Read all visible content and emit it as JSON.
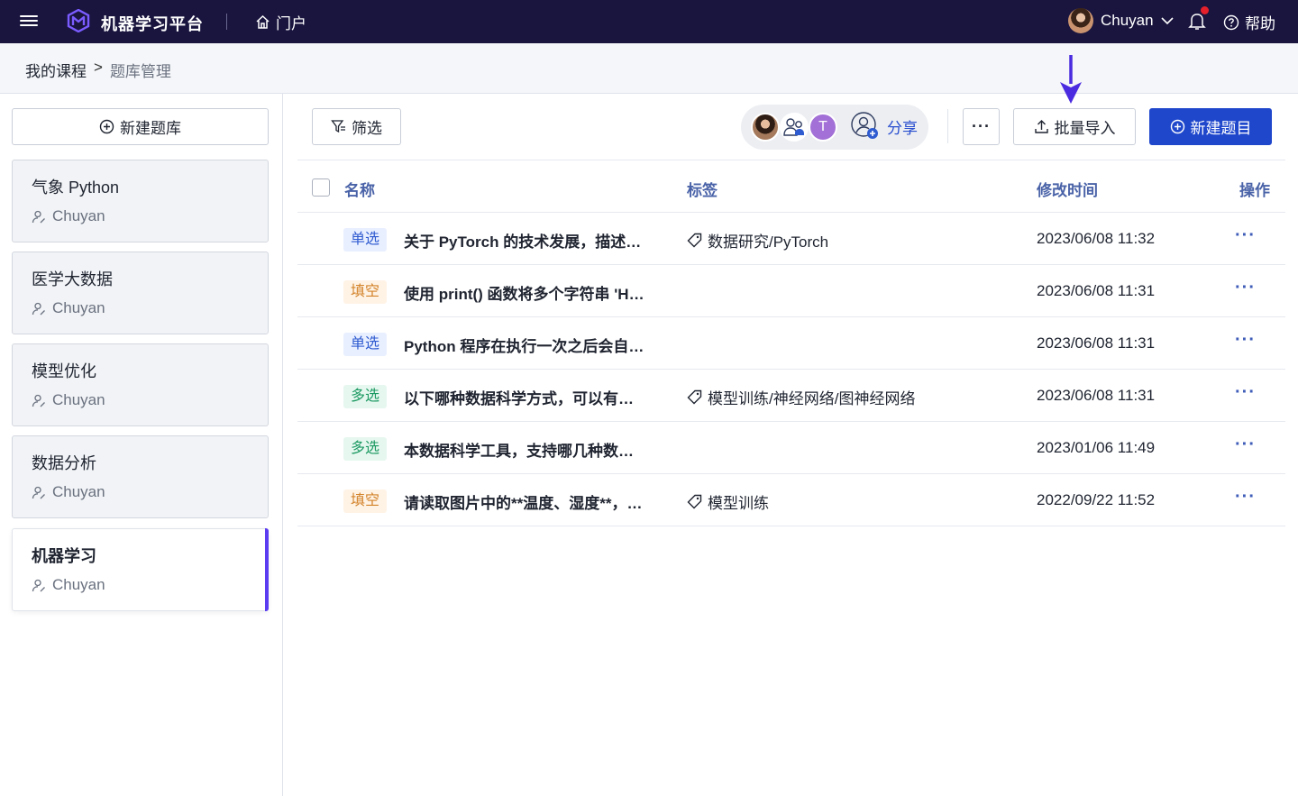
{
  "header": {
    "app_title": "机器学习平台",
    "portal_label": "门户",
    "user_name": "Chuyan",
    "help_label": "帮助"
  },
  "breadcrumb": {
    "parent": "我的课程",
    "separator": ">",
    "current": "题库管理"
  },
  "sidebar": {
    "new_bank_label": "新建题库",
    "banks": [
      {
        "name": "气象 Python",
        "owner": "Chuyan"
      },
      {
        "name": "医学大数据",
        "owner": "Chuyan"
      },
      {
        "name": "模型优化",
        "owner": "Chuyan"
      },
      {
        "name": "数据分析",
        "owner": "Chuyan"
      },
      {
        "name": "机器学习",
        "owner": "Chuyan",
        "active": true
      }
    ]
  },
  "toolbar": {
    "filter_label": "筛选",
    "member_initial": "T",
    "share_label": "分享",
    "more_label": "···",
    "import_label": "批量导入",
    "new_question_label": "新建题目"
  },
  "table": {
    "columns": {
      "name": "名称",
      "tags": "标签",
      "modified": "修改时间",
      "actions": "操作"
    },
    "rows": [
      {
        "type": "单选",
        "type_key": "single",
        "title": "关于 PyTorch 的技术发展，描述…",
        "tag": "数据研究/PyTorch",
        "time": "2023/06/08 11:32"
      },
      {
        "type": "填空",
        "type_key": "fill",
        "title": "使用 print() 函数将多个字符串 'H…",
        "tag": "",
        "time": "2023/06/08 11:31"
      },
      {
        "type": "单选",
        "type_key": "single",
        "title": "Python 程序在执行一次之后会自…",
        "tag": "",
        "time": "2023/06/08 11:31"
      },
      {
        "type": "多选",
        "type_key": "multi",
        "title": "以下哪种数据科学方式，可以有…",
        "tag": "模型训练/神经网络/图神经网络",
        "time": "2023/06/08 11:31"
      },
      {
        "type": "多选",
        "type_key": "multi",
        "title": "本数据科学工具，支持哪几种数…",
        "tag": "",
        "time": "2023/01/06 11:49"
      },
      {
        "type": "填空",
        "type_key": "fill",
        "title": "请读取图片中的**温度、湿度**，…",
        "tag": "模型训练",
        "time": "2022/09/22 11:52"
      }
    ]
  },
  "colors": {
    "nav_bg": "#19153f",
    "primary": "#1f47cc",
    "accent_bar": "#5b3cf0",
    "annotation_arrow": "#4b2be0"
  }
}
